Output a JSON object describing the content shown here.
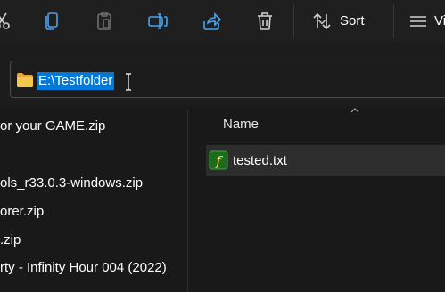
{
  "toolbar": {
    "icons": [
      "cut-icon",
      "copy-icon",
      "paste-icon",
      "rename-icon",
      "share-icon",
      "delete-icon"
    ],
    "sort_label": "Sort",
    "view_label": "Vi"
  },
  "address": {
    "path": "E:\\Testfolder",
    "icon": "folder-icon"
  },
  "nav_pane": {
    "items": [
      "or your GAME.zip",
      "ols_r33.0.3-windows.zip",
      "orer.zip",
      ".zip",
      "rty - Infinity Hour 004 (2022)"
    ]
  },
  "file_list": {
    "column_name": "Name",
    "files": [
      {
        "name": "tested.txt",
        "icon": "script-file-icon"
      }
    ]
  },
  "colors": {
    "selection": "#0078d7",
    "folder": "#f3c24f",
    "file_icon_bg": "#1d6b1d",
    "background": "#191919"
  }
}
